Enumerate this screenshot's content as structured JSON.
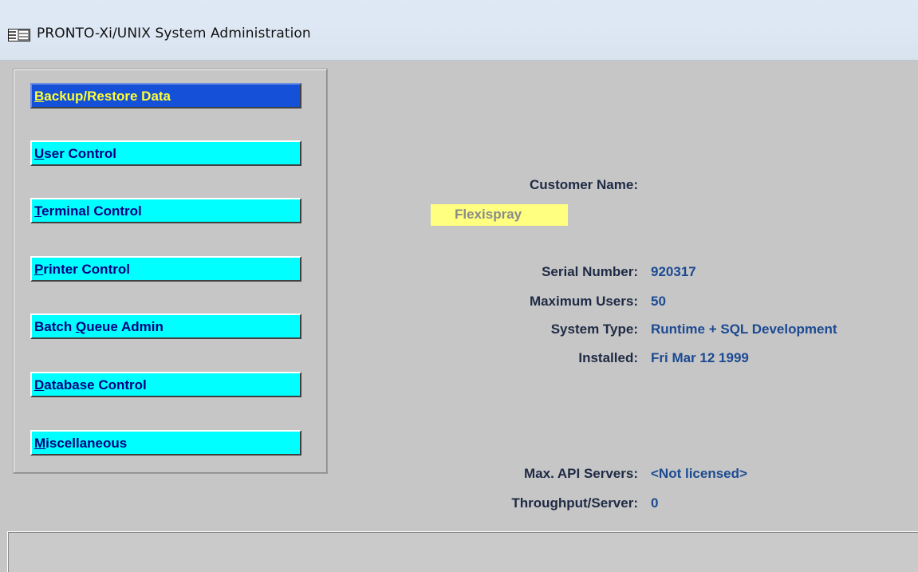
{
  "window": {
    "title": "PRONTO-Xi/UNIX System Administration",
    "icon": "form-window-icon"
  },
  "menu": [
    {
      "key": "backup",
      "prefix": "",
      "mnemonic": "B",
      "rest": "ackup/Restore Data",
      "active": true
    },
    {
      "key": "user",
      "prefix": "",
      "mnemonic": "U",
      "rest": "ser Control",
      "active": false
    },
    {
      "key": "terminal",
      "prefix": "",
      "mnemonic": "T",
      "rest": "erminal Control",
      "active": false
    },
    {
      "key": "printer",
      "prefix": "",
      "mnemonic": "P",
      "rest": "rinter Control",
      "active": false
    },
    {
      "key": "batch",
      "prefix": "Batch ",
      "mnemonic": "Q",
      "rest": "ueue Admin",
      "active": false
    },
    {
      "key": "database",
      "prefix": "",
      "mnemonic": "D",
      "rest": "atabase Control",
      "active": false
    },
    {
      "key": "misc",
      "prefix": "",
      "mnemonic": "M",
      "rest": "iscellaneous",
      "active": false
    }
  ],
  "info": {
    "customer_name_label": "Customer Name:",
    "customer_name_value": "Flexispray",
    "serial_number_label": "Serial Number:",
    "serial_number_value": "920317",
    "max_users_label": "Maximum Users:",
    "max_users_value": "50",
    "system_type_label": "System Type:",
    "system_type_value": "Runtime + SQL Development",
    "installed_label": "Installed:",
    "installed_value": "Fri Mar 12 1999",
    "max_api_label": "Max. API Servers:",
    "max_api_value": "<Not licensed>",
    "throughput_label": "Throughput/Server:",
    "throughput_value": "0"
  },
  "colors": {
    "button_bg": "#00ffff",
    "button_active_bg": "#1450d8",
    "button_text": "#000080",
    "button_active_text": "#ffff33",
    "value_text": "#1c4a92",
    "field_bg": "#ffff80",
    "window_bg": "#c6c6c6"
  }
}
